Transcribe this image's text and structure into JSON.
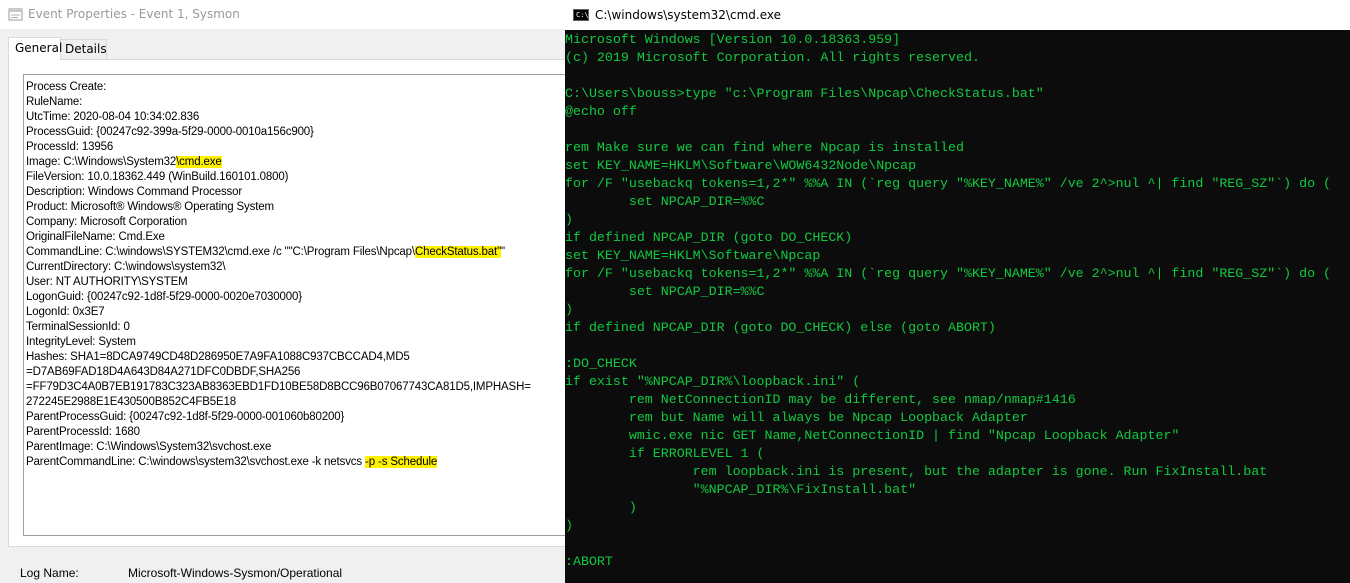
{
  "event_window": {
    "title": "Event Properties - Event 1, Sysmon",
    "tabs": [
      {
        "label": "General",
        "active": true
      },
      {
        "label": "Details",
        "active": false
      }
    ],
    "lines": [
      [
        {
          "t": "Process Create:"
        }
      ],
      [
        {
          "t": "RuleName:"
        }
      ],
      [
        {
          "t": "UtcTime: 2020-08-04 10:34:02.836"
        }
      ],
      [
        {
          "t": "ProcessGuid: {00247c92-399a-5f29-0000-0010a156c900}"
        }
      ],
      [
        {
          "t": "ProcessId: 13956"
        }
      ],
      [
        {
          "t": "Image: C:\\Windows\\System32"
        },
        {
          "t": "\\cmd.exe",
          "hl": true
        }
      ],
      [
        {
          "t": "FileVersion: 10.0.18362.449 (WinBuild.160101.0800)"
        }
      ],
      [
        {
          "t": "Description: Windows Command Processor"
        }
      ],
      [
        {
          "t": "Product: Microsoft® Windows® Operating System"
        }
      ],
      [
        {
          "t": "Company: Microsoft Corporation"
        }
      ],
      [
        {
          "t": "OriginalFileName: Cmd.Exe"
        }
      ],
      [
        {
          "t": "CommandLine: C:\\windows\\SYSTEM32\\cmd.exe /c \"\"C:\\Program Files\\Npcap\\"
        },
        {
          "t": "CheckStatus.bat\"",
          "hl": true
        },
        {
          "t": "\""
        }
      ],
      [
        {
          "t": "CurrentDirectory: C:\\windows\\system32\\"
        }
      ],
      [
        {
          "t": "User: NT AUTHORITY\\SYSTEM"
        }
      ],
      [
        {
          "t": "LogonGuid: {00247c92-1d8f-5f29-0000-0020e7030000}"
        }
      ],
      [
        {
          "t": "LogonId: 0x3E7"
        }
      ],
      [
        {
          "t": "TerminalSessionId: 0"
        }
      ],
      [
        {
          "t": "IntegrityLevel: System"
        }
      ],
      [
        {
          "t": "Hashes: SHA1=8DCA9749CD48D286950E7A9FA1088C937CBCCAD4,MD5"
        }
      ],
      [
        {
          "t": "=D7AB69FAD18D4A643D84A271DFC0DBDF,SHA256"
        }
      ],
      [
        {
          "t": "=FF79D3C4A0B7EB191783C323AB8363EBD1FD10BE58D8BCC96B07067743CA81D5,IMPHASH="
        }
      ],
      [
        {
          "t": "272245E2988E1E430500B852C4FB5E18"
        }
      ],
      [
        {
          "t": "ParentProcessGuid: {00247c92-1d8f-5f29-0000-001060b80200}"
        }
      ],
      [
        {
          "t": "ParentProcessId: 1680"
        }
      ],
      [
        {
          "t": "ParentImage: C:\\Windows\\System32\\svchost.exe"
        }
      ],
      [
        {
          "t": "ParentCommandLine: C:\\windows\\system32\\svchost.exe -k netsvcs "
        },
        {
          "t": "-p -s Schedule",
          "hl": true
        }
      ]
    ],
    "log_name_label": "Log Name:",
    "log_name_value": "Microsoft-Windows-Sysmon/Operational"
  },
  "cmd_window": {
    "title": "C:\\windows\\system32\\cmd.exe",
    "icon_text": "C:\\",
    "text_color": "#13c940",
    "lines": [
      "Microsoft Windows [Version 10.0.18363.959]",
      "(c) 2019 Microsoft Corporation. All rights reserved.",
      "",
      "C:\\Users\\bouss>type \"c:\\Program Files\\Npcap\\CheckStatus.bat\"",
      "@echo off",
      "",
      "rem Make sure we can find where Npcap is installed",
      "set KEY_NAME=HKLM\\Software\\WOW6432Node\\Npcap",
      "for /F \"usebackq tokens=1,2*\" %%A IN (`reg query \"%KEY_NAME%\" /ve 2^>nul ^| find \"REG_SZ\"`) do (",
      "        set NPCAP_DIR=%%C",
      ")",
      "if defined NPCAP_DIR (goto DO_CHECK)",
      "set KEY_NAME=HKLM\\Software\\Npcap",
      "for /F \"usebackq tokens=1,2*\" %%A IN (`reg query \"%KEY_NAME%\" /ve 2^>nul ^| find \"REG_SZ\"`) do (",
      "        set NPCAP_DIR=%%C",
      ")",
      "if defined NPCAP_DIR (goto DO_CHECK) else (goto ABORT)",
      "",
      ":DO_CHECK",
      "if exist \"%NPCAP_DIR%\\loopback.ini\" (",
      "        rem NetConnectionID may be different, see nmap/nmap#1416",
      "        rem but Name will always be Npcap Loopback Adapter",
      "        wmic.exe nic GET Name,NetConnectionID | find \"Npcap Loopback Adapter\"",
      "        if ERRORLEVEL 1 (",
      "                rem loopback.ini is present, but the adapter is gone. Run FixInstall.bat",
      "                \"%NPCAP_DIR%\\FixInstall.bat\"",
      "        )",
      ")",
      "",
      ":ABORT"
    ]
  }
}
